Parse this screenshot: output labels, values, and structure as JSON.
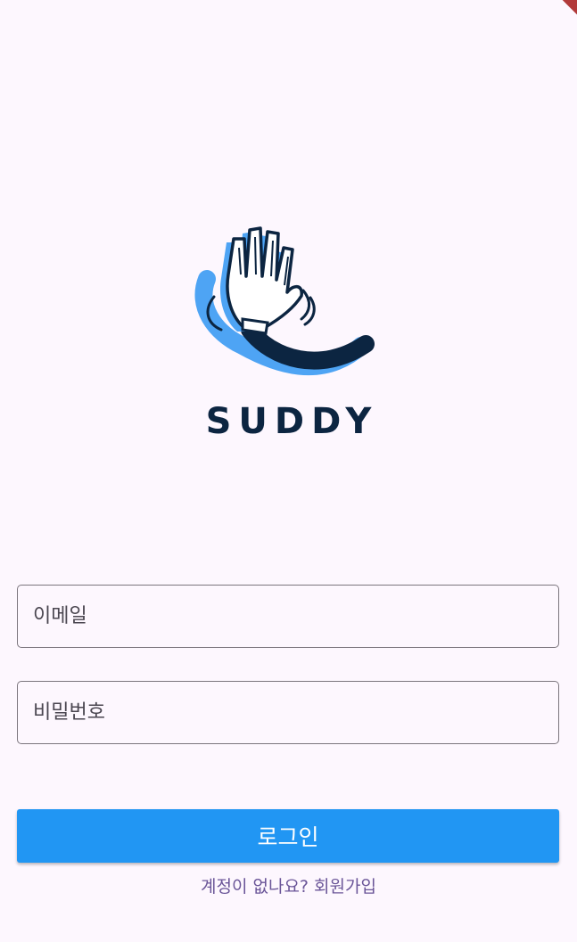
{
  "app": {
    "brand_name": "SUDDY",
    "logo_icon": "waving-glove-hand-icon",
    "colors": {
      "background": "#fdf7fe",
      "brand_navy": "#0c2541",
      "brand_blue": "#4ea4f4",
      "primary_button": "#2196f3",
      "link": "#6a5598"
    }
  },
  "form": {
    "email_placeholder": "이메일",
    "password_placeholder": "비밀번호",
    "login_label": "로그인",
    "signup_link": "계정이 없나요? 회원가입"
  }
}
